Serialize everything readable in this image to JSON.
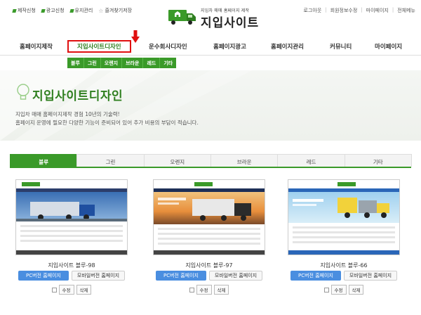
{
  "util": {
    "links": [
      "제작신청",
      "광고신청",
      "유지관리"
    ],
    "favorite": "즐겨찾기저장",
    "right": [
      "로그아웃",
      "회원정보수정",
      "마이페이지",
      "전체메뉴"
    ]
  },
  "logo": {
    "tagline": "지입차 매매 홈페이지 제작",
    "name": "지입사이트"
  },
  "nav": {
    "items": [
      "홈페이지제작",
      "지입사이트디자인",
      "운수회사디자인",
      "홈페이지광고",
      "홈페이지관리",
      "커뮤니티",
      "마이페이지"
    ],
    "sub": [
      "블루",
      "그린",
      "오렌지",
      "브라운",
      "레드",
      "기타"
    ]
  },
  "hero": {
    "title": "지입사이트디자인",
    "desc1": "지입차 매매 홈페이지제작 경험 10년의 기술력!",
    "desc2": "홈페이지 운영에 필요한 다양한 기능이 준비되어 있어 추가 비용의 부담이 적습니다."
  },
  "tabs": [
    "블루",
    "그린",
    "오렌지",
    "브라운",
    "레드",
    "기타"
  ],
  "cards": [
    {
      "title": "지입사이트 블루-98",
      "pc": "PC버전 홈페이지",
      "mobile": "모바일버전 홈페이지",
      "edit": "수정",
      "delete": "삭제"
    },
    {
      "title": "지입사이트 블루-97",
      "pc": "PC버전 홈페이지",
      "mobile": "모바일버전 홈페이지",
      "edit": "수정",
      "delete": "삭제"
    },
    {
      "title": "지입사이트 블루-66",
      "pc": "PC버전 홈페이지",
      "mobile": "모바일버전 홈페이지",
      "edit": "수정",
      "delete": "삭제"
    }
  ],
  "colors": {
    "brand_green": "#3a9a29",
    "active_outline": "#e01010",
    "pc_button": "#4a8ee0"
  }
}
